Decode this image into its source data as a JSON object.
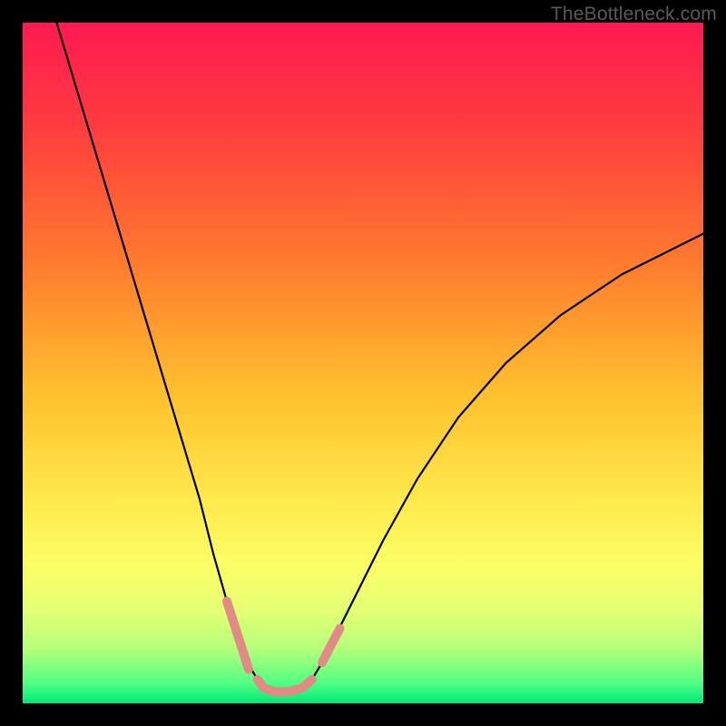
{
  "watermark": "TheBottleneck.com",
  "chart_data": {
    "type": "line",
    "title": "",
    "xlabel": "",
    "ylabel": "",
    "xlim": [
      0,
      100
    ],
    "ylim": [
      0,
      100
    ],
    "background_gradient": {
      "type": "vertical",
      "stops": [
        {
          "pos": 0.0,
          "color": "#ff1a52"
        },
        {
          "pos": 0.15,
          "color": "#ff3b3f"
        },
        {
          "pos": 0.35,
          "color": "#ff7a2e"
        },
        {
          "pos": 0.55,
          "color": "#ffc22e"
        },
        {
          "pos": 0.7,
          "color": "#ffe94b"
        },
        {
          "pos": 0.8,
          "color": "#fbff66"
        },
        {
          "pos": 0.86,
          "color": "#e6ff73"
        },
        {
          "pos": 0.92,
          "color": "#b5ff7a"
        },
        {
          "pos": 0.97,
          "color": "#52ff83"
        },
        {
          "pos": 1.0,
          "color": "#00e878"
        }
      ]
    },
    "series": [
      {
        "name": "left-branch",
        "x": [
          5,
          8,
          11,
          14,
          17,
          20,
          23,
          26,
          28,
          30,
          31.5,
          33,
          34.5
        ],
        "y": [
          100,
          90,
          80,
          70,
          60,
          50,
          40,
          30,
          22,
          15,
          10,
          6,
          3.5
        ],
        "stroke": "#000000",
        "width": 2.2
      },
      {
        "name": "right-branch",
        "x": [
          42.5,
          44,
          46,
          49,
          53,
          58,
          64,
          71,
          79,
          88,
          98,
          100
        ],
        "y": [
          3.5,
          6,
          10,
          16,
          24,
          33,
          42,
          50,
          57,
          63,
          68,
          69
        ],
        "stroke": "#000000",
        "width": 2.2
      },
      {
        "name": "valley-floor",
        "x": [
          34.5,
          35.5,
          37,
          39,
          41,
          42.5
        ],
        "y": [
          3.5,
          2.2,
          1.7,
          1.7,
          2.2,
          3.5
        ],
        "stroke": "#e28a85",
        "width": 10
      },
      {
        "name": "left-pink-segment",
        "x": [
          30.0,
          33.2
        ],
        "y": [
          15,
          5
        ],
        "stroke": "#e28a85",
        "width": 10
      },
      {
        "name": "right-pink-segment",
        "x": [
          44.0,
          46.6
        ],
        "y": [
          6,
          11
        ],
        "stroke": "#e28a85",
        "width": 10
      }
    ],
    "series_render_order": [
      "left-branch",
      "right-branch",
      "left-pink-segment",
      "right-pink-segment",
      "valley-floor"
    ]
  }
}
